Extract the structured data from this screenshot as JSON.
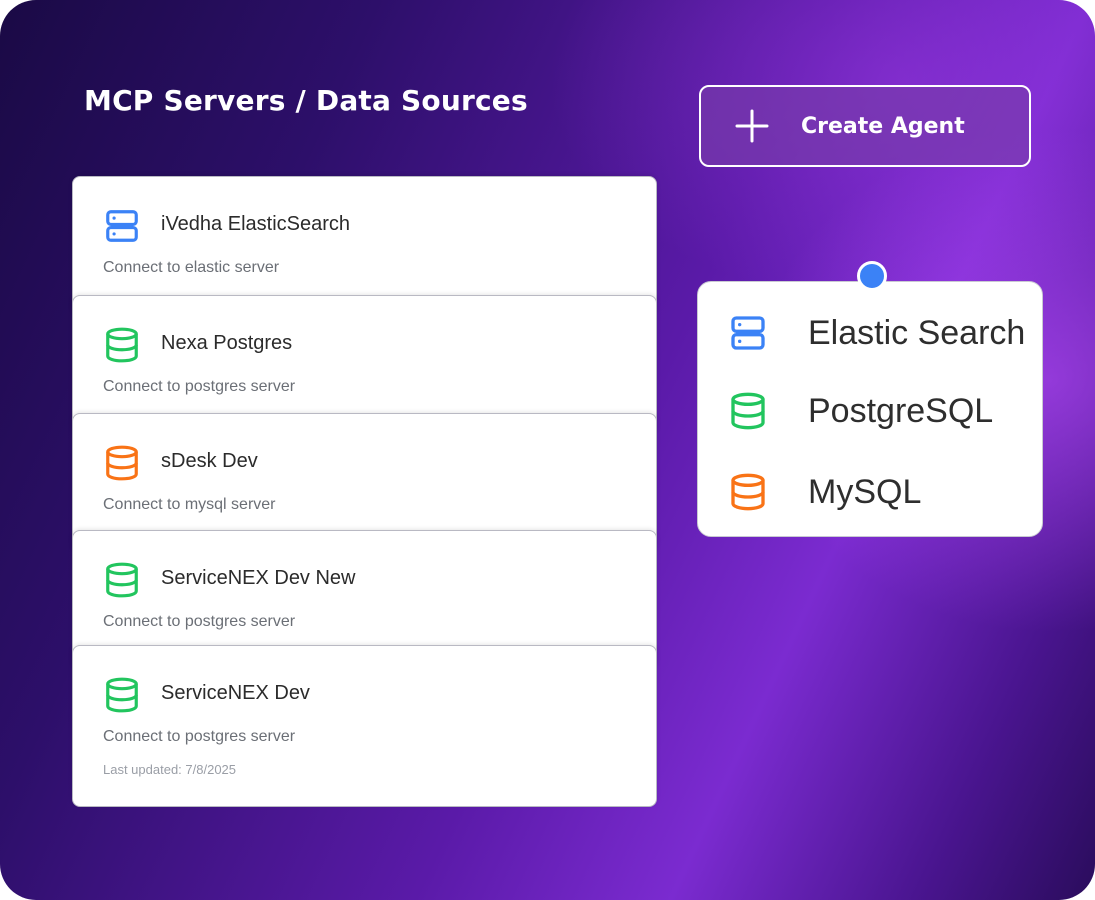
{
  "header": {
    "title": "MCP Servers / Data Sources",
    "create_button_label": "Create Agent"
  },
  "colors": {
    "elastic": "#3b82f6",
    "postgres": "#22c55e",
    "mysql": "#f97316"
  },
  "servers": [
    {
      "name": "iVedha ElasticSearch",
      "description": "Connect to elastic server",
      "icon": "server-icon",
      "type": "elastic"
    },
    {
      "name": "Nexa Postgres",
      "description": "Connect to postgres server",
      "icon": "database-icon",
      "type": "postgres"
    },
    {
      "name": "sDesk Dev",
      "description": "Connect to mysql server",
      "icon": "database-icon",
      "type": "mysql"
    },
    {
      "name": "ServiceNEX Dev New",
      "description": "Connect to postgres server",
      "icon": "database-icon",
      "type": "postgres"
    },
    {
      "name": "ServiceNEX Dev",
      "description": "Connect to postgres server",
      "updated": "Last updated: 7/8/2025",
      "icon": "database-icon",
      "type": "postgres"
    }
  ],
  "source_menu": {
    "items": [
      {
        "label": "Elastic Search",
        "icon": "server-icon",
        "type": "elastic"
      },
      {
        "label": "PostgreSQL",
        "icon": "database-icon",
        "type": "postgres"
      },
      {
        "label": "MySQL",
        "icon": "database-icon",
        "type": "mysql"
      }
    ]
  }
}
